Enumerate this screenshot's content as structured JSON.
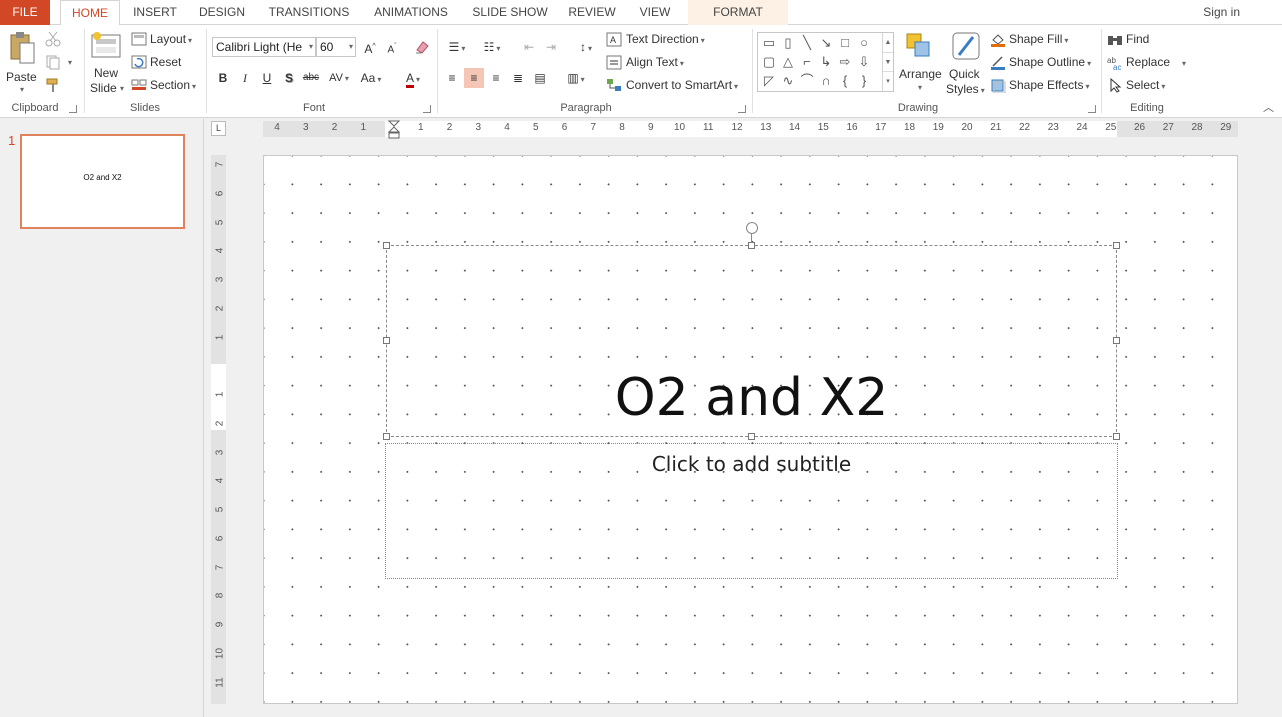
{
  "tabs": {
    "file": "FILE",
    "home": "HOME",
    "insert": "INSERT",
    "design": "DESIGN",
    "transitions": "TRANSITIONS",
    "animations": "ANIMATIONS",
    "slideshow": "SLIDE SHOW",
    "review": "REVIEW",
    "view": "VIEW",
    "format": "FORMAT"
  },
  "signin": "Sign in",
  "clipboard": {
    "paste": "Paste",
    "label": "Clipboard"
  },
  "slides": {
    "new_slide_1": "New",
    "new_slide_2": "Slide",
    "layout": "Layout",
    "reset": "Reset",
    "section": "Section",
    "label": "Slides"
  },
  "font": {
    "name": "Calibri Light (He",
    "size": "60",
    "label": "Font"
  },
  "paragraph": {
    "text_direction": "Text Direction",
    "align_text": "Align Text",
    "convert_smartart": "Convert to SmartArt",
    "label": "Paragraph"
  },
  "drawing": {
    "arrange": "Arrange",
    "quick_styles_1": "Quick",
    "quick_styles_2": "Styles",
    "shape_fill": "Shape Fill",
    "shape_outline": "Shape Outline",
    "shape_effects": "Shape Effects",
    "label": "Drawing"
  },
  "editing": {
    "find": "Find",
    "replace": "Replace",
    "select": "Select",
    "label": "Editing"
  },
  "thumbnails": [
    {
      "number": "1",
      "title": "O2 and X2"
    }
  ],
  "ruler": {
    "horizontal": [
      "4",
      "3",
      "2",
      "1",
      "1",
      "2",
      "3",
      "4",
      "5",
      "6",
      "7",
      "8",
      "9",
      "10",
      "11",
      "12",
      "13",
      "14",
      "15",
      "16",
      "17",
      "18",
      "19",
      "20",
      "21",
      "22",
      "23",
      "24",
      "25",
      "26",
      "27",
      "28",
      "29"
    ],
    "vertical": [
      "7",
      "6",
      "5",
      "4",
      "3",
      "2",
      "1",
      "1",
      "2",
      "3",
      "4",
      "5",
      "6",
      "7",
      "8",
      "9",
      "10",
      "11"
    ],
    "corner": "L"
  },
  "slide": {
    "title": "O2 and X2",
    "subtitle_placeholder": "Click to add subtitle"
  },
  "colors": {
    "accent": "#d24726",
    "selected_align": "#f5c6b6"
  }
}
